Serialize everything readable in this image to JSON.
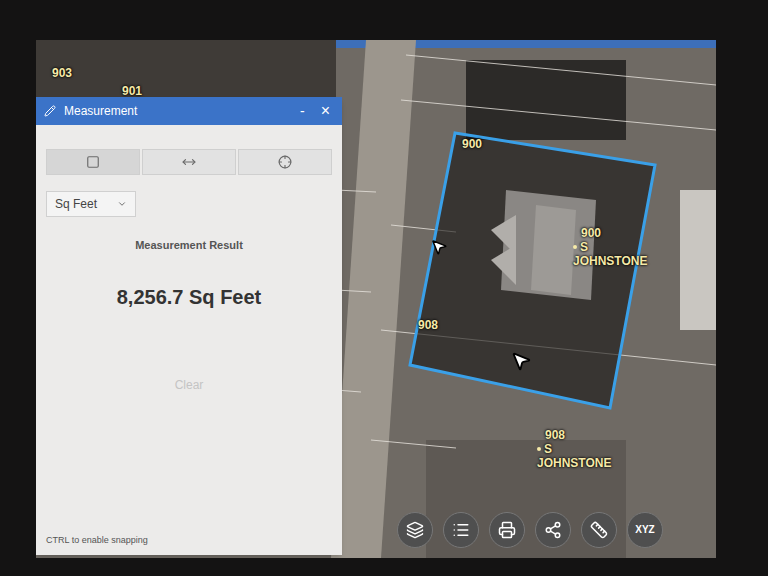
{
  "panel": {
    "title": "Measurement",
    "minimize": "-",
    "close": "×",
    "tools": [
      {
        "kind": "area",
        "selected": true
      },
      {
        "kind": "distance",
        "selected": false
      },
      {
        "kind": "location",
        "selected": false
      }
    ],
    "unit": "Sq Feet",
    "result_label": "Measurement Result",
    "result": "8,256.7 Sq Feet",
    "clear": {
      "label": "Clear",
      "disabled": true
    },
    "hint": "CTRL to enable snapping"
  },
  "map": {
    "parcel_labels": [
      "903",
      "901",
      "900",
      "908"
    ],
    "addresses": [
      {
        "number": "900",
        "direction": "S",
        "street": "JOHNSTONE"
      },
      {
        "number": "908",
        "direction": "S",
        "street": "JOHNSTONE"
      }
    ]
  },
  "toolbar": [
    {
      "kind": "layers"
    },
    {
      "kind": "legend"
    },
    {
      "kind": "print"
    },
    {
      "kind": "share"
    },
    {
      "kind": "measure"
    },
    {
      "kind": "coordinates",
      "label": "XYZ"
    }
  ]
}
